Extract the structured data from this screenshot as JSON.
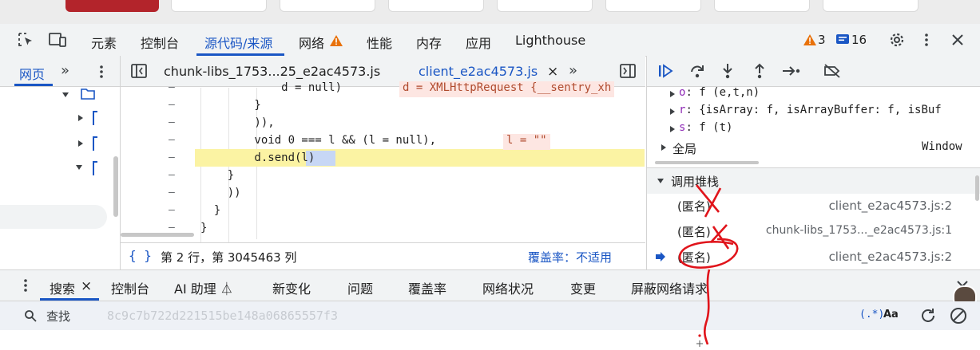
{
  "devtools_tabs": [
    {
      "label": "元素"
    },
    {
      "label": "控制台"
    },
    {
      "label": "源代码/来源"
    },
    {
      "label": "网络"
    },
    {
      "label": "性能"
    },
    {
      "label": "内存"
    },
    {
      "label": "应用"
    },
    {
      "label": "Lighthouse"
    }
  ],
  "badges": {
    "warnings": "3",
    "messages": "16"
  },
  "navigator": {
    "tab": "网页",
    "more": "»"
  },
  "editor": {
    "tabs": [
      {
        "label": "chunk-libs_1753...25_e2ac4573.js"
      },
      {
        "label": "client_e2ac4573.js"
      }
    ],
    "close_glyph": "×",
    "more": "»",
    "code_lines": [
      {
        "gutter": "–",
        "text": "            d = null)"
      },
      {
        "gutter": "–",
        "text": "        }"
      },
      {
        "gutter": "–",
        "text": "        )),"
      },
      {
        "gutter": "–",
        "text": "        void 0 === l && (l = null),"
      },
      {
        "gutter": "–",
        "text": "        d.send(l)"
      },
      {
        "gutter": "–",
        "text": "    }"
      },
      {
        "gutter": "–",
        "text": "    ))"
      },
      {
        "gutter": "–",
        "text": "  }"
      },
      {
        "gutter": "–",
        "text": "}"
      }
    ],
    "inline_values": {
      "d": "d = XMLHttpRequest {__sentry_xh",
      "l": "l = \"\""
    },
    "status": {
      "position": "第 2 行，第 3045463 列",
      "coverage": "覆盖率：不适用",
      "braces": "{ }"
    }
  },
  "scope": {
    "lines": [
      {
        "key": "o",
        "value": "f (e,t,n)"
      },
      {
        "key": "r",
        "value": "{isArray: f, isArrayBuffer: f, isBuf"
      },
      {
        "key": "s",
        "value": "f (t)"
      }
    ],
    "global_label": "全局",
    "global_value": "Window"
  },
  "call_stack": {
    "title": "调用堆栈",
    "frames": [
      {
        "name": "(匿名)",
        "location": "client_e2ac4573.js:2",
        "current": false
      },
      {
        "name": "(匿名)",
        "location": "chunk-libs_1753..._e2ac4573.js:1",
        "current": false
      },
      {
        "name": "(匿名)",
        "location": "client_e2ac4573.js:2",
        "current": true
      }
    ]
  },
  "drawer": {
    "tabs": [
      {
        "label": "搜索"
      },
      {
        "label": "控制台"
      },
      {
        "label": "AI 助理 ⏃"
      },
      {
        "label": "新变化"
      },
      {
        "label": "问题"
      },
      {
        "label": "覆盖率"
      },
      {
        "label": "网络状况"
      },
      {
        "label": "变更"
      },
      {
        "label": "屏蔽网络请求"
      }
    ],
    "close_glyph": "×",
    "search_placeholder": "查找",
    "regex_label": "(.*)",
    "case_label": "Aa",
    "faint_text": "8c9c7b722d221515be148a06865557f3"
  },
  "colors": {
    "accent": "#1a56c4",
    "warning": "#e8710a",
    "annotation": "#e0141b",
    "highlight": "#fbf3a3"
  }
}
